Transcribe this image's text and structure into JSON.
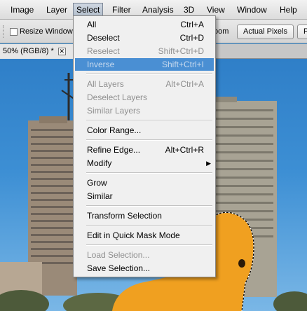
{
  "menubar": {
    "items": [
      "Image",
      "Layer",
      "Select",
      "Filter",
      "Analysis",
      "3D",
      "View",
      "Window",
      "Help"
    ],
    "active_index": 2
  },
  "options_bar": {
    "resize_windows_label": "Resize Windows T",
    "zoom_label": "oom",
    "actual_pixels": "Actual Pixels",
    "fit_label": "Fi"
  },
  "document_tab": {
    "title": "50% (RGB/8) *",
    "close_symbol": "✕"
  },
  "select_menu": {
    "items": [
      {
        "label": "All",
        "shortcut": "Ctrl+A",
        "disabled": false
      },
      {
        "label": "Deselect",
        "shortcut": "Ctrl+D",
        "disabled": false
      },
      {
        "label": "Reselect",
        "shortcut": "Shift+Ctrl+D",
        "disabled": true
      },
      {
        "label": "Inverse",
        "shortcut": "Shift+Ctrl+I",
        "disabled": true,
        "highlighted": true
      },
      {
        "label": "All Layers",
        "shortcut": "Alt+Ctrl+A",
        "disabled": true
      },
      {
        "label": "Deselect Layers",
        "shortcut": "",
        "disabled": true
      },
      {
        "label": "Similar Layers",
        "shortcut": "",
        "disabled": true
      },
      {
        "label": "Color Range...",
        "shortcut": "",
        "disabled": false
      },
      {
        "label": "Refine Edge...",
        "shortcut": "Alt+Ctrl+R",
        "disabled": false
      },
      {
        "label": "Modify",
        "shortcut": "",
        "disabled": false,
        "submenu": true
      },
      {
        "label": "Grow",
        "shortcut": "",
        "disabled": false
      },
      {
        "label": "Similar",
        "shortcut": "",
        "disabled": false
      },
      {
        "label": "Transform Selection",
        "shortcut": "",
        "disabled": false
      },
      {
        "label": "Edit in Quick Mask Mode",
        "shortcut": "",
        "disabled": false
      },
      {
        "label": "Load Selection...",
        "shortcut": "",
        "disabled": true
      },
      {
        "label": "Save Selection...",
        "shortcut": "",
        "disabled": false
      }
    ],
    "submenu_arrow": "▶"
  },
  "colors": {
    "menu_highlight": "#4a8fd3",
    "disabled_text": "#8f8f8f",
    "duck_yellow": "#f0a020"
  }
}
